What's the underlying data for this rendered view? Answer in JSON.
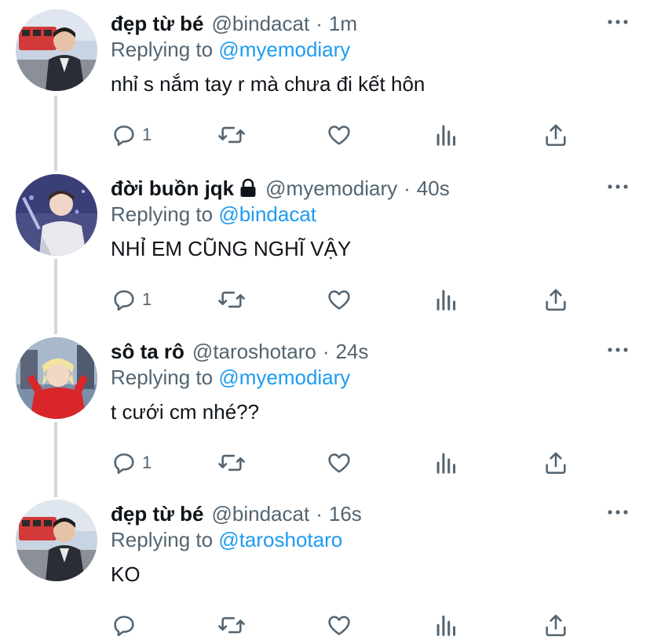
{
  "tweets": [
    {
      "name": "đẹp từ bé",
      "handle": "@bindacat",
      "dot": "·",
      "time": "1m",
      "replying_prefix": "Replying to",
      "replying_to": "@myemodiary",
      "text": "nhỉ s nắm tay r mà chưa đi kết hôn",
      "reply_count": "1",
      "avatar": "avatar-bindacat",
      "locked": false
    },
    {
      "name": "đời buồn jqk",
      "handle": "@myemodiary",
      "dot": "·",
      "time": "40s",
      "replying_prefix": "Replying to",
      "replying_to": "@bindacat",
      "text": "NHỈ EM CŨNG NGHĨ VẬY",
      "reply_count": "1",
      "avatar": "avatar-myemodiary",
      "locked": true
    },
    {
      "name": "sô ta rô",
      "handle": "@taroshotaro",
      "dot": "·",
      "time": "24s",
      "replying_prefix": "Replying to",
      "replying_to": "@myemodiary",
      "text": "t cưới cm nhé??",
      "reply_count": "1",
      "avatar": "avatar-taroshotaro",
      "locked": false
    },
    {
      "name": "đẹp từ bé",
      "handle": "@bindacat",
      "dot": "·",
      "time": "16s",
      "replying_prefix": "Replying to",
      "replying_to": "@taroshotaro",
      "text": "KO",
      "reply_count": "",
      "avatar": "avatar-bindacat",
      "locked": false
    }
  ],
  "icons": {
    "reply": "reply-icon",
    "retweet": "retweet-icon",
    "like": "heart-icon",
    "analytics": "analytics-icon",
    "share": "share-icon",
    "more": "more-icon",
    "lock": "lock-icon"
  },
  "colors": {
    "text": "#0f1419",
    "secondary": "#536471",
    "link": "#1d9bf0",
    "thread_line": "#cfd9de"
  }
}
